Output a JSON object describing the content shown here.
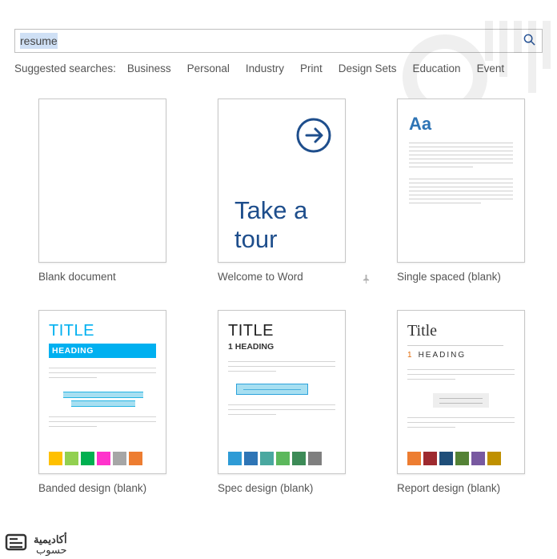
{
  "search": {
    "value": "resume",
    "placeholder": ""
  },
  "suggested": {
    "label": "Suggested searches:",
    "items": [
      "Business",
      "Personal",
      "Industry",
      "Print",
      "Design Sets",
      "Education",
      "Event"
    ]
  },
  "templates": [
    {
      "label": "Blank document"
    },
    {
      "label": "Welcome to Word",
      "tour_text": "Take a tour",
      "pinned": true
    },
    {
      "label": "Single spaced (blank)",
      "aa": "Aa"
    },
    {
      "label": "Banded design (blank)",
      "title": "TITLE",
      "heading": "HEADING",
      "swatches": [
        "#ffc000",
        "#92d050",
        "#00b050",
        "#ff33cc",
        "#a6a6a6",
        "#ed7d31"
      ]
    },
    {
      "label": "Spec design (blank)",
      "title": "TITLE",
      "heading": "1 HEADING",
      "swatches": [
        "#2e9bd6",
        "#2e75b6",
        "#4aa8a0",
        "#5cb85c",
        "#3d8b57",
        "#7f7f7f"
      ]
    },
    {
      "label": "Report design (blank)",
      "title": "Title",
      "num": "1",
      "heading": "HEADING",
      "swatches": [
        "#ed7d31",
        "#9e2a2f",
        "#1f4e79",
        "#548235",
        "#7859a0",
        "#bf9000"
      ]
    }
  ],
  "footer": {
    "top": "أكاديمية",
    "bottom": "حسوب"
  }
}
